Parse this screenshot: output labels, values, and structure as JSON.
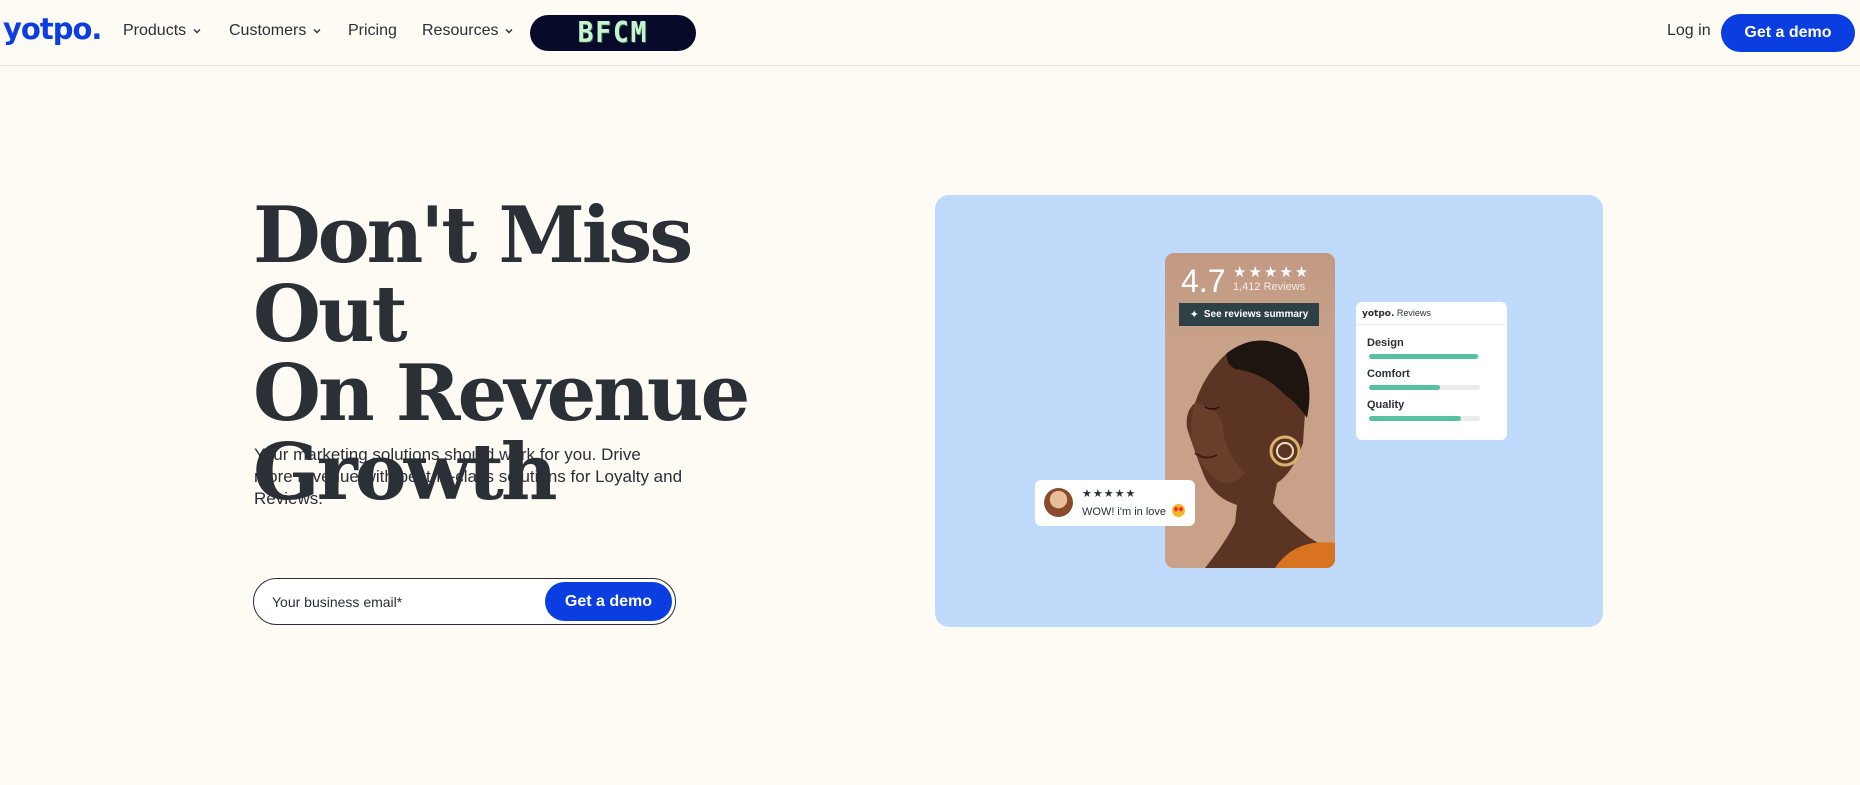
{
  "header": {
    "logo": "yotpo.",
    "nav": [
      {
        "label": "Products",
        "dropdown": true
      },
      {
        "label": "Customers",
        "dropdown": true
      },
      {
        "label": "Pricing",
        "dropdown": false
      },
      {
        "label": "Resources",
        "dropdown": true
      }
    ],
    "promo_badge": "BFCM",
    "login": "Log in",
    "cta": "Get a demo"
  },
  "hero": {
    "headline_lines": [
      "Don't Miss Out",
      "On Revenue",
      "Growth"
    ],
    "subcopy": "Your marketing solutions should work for you. Drive more revenue with best-in-class solutions for Loyalty and Reviews.",
    "email_placeholder": "Your business email*",
    "email_value": "",
    "cta": "Get a demo"
  },
  "visual": {
    "rating": "4.7",
    "rating_stars": "★★★★★",
    "reviews_count": "1,412 Reviews",
    "summary_button": "See reviews summary",
    "review_widget": {
      "brand": "yotpo.",
      "title": "Reviews",
      "attributes": [
        {
          "label": "Design",
          "score": 0.98
        },
        {
          "label": "Comfort",
          "score": 0.64
        },
        {
          "label": "Quality",
          "score": 0.83
        }
      ]
    },
    "user_review": {
      "stars": "★★★★★",
      "text": "WOW! i'm in love"
    }
  },
  "colors": {
    "brand_blue": "#0a3ee0",
    "background": "#fefbf4",
    "visual_panel": "#c0dafb",
    "bar_fill": "#5ac0a2",
    "bfcm_bg": "#070a29"
  }
}
